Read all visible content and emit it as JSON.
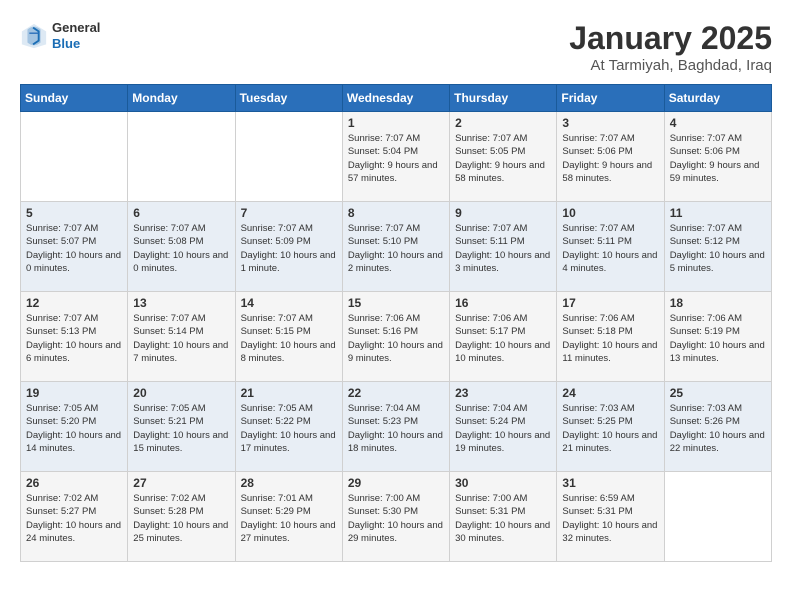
{
  "header": {
    "logo_general": "General",
    "logo_blue": "Blue",
    "title": "January 2025",
    "subtitle": "At Tarmiyah, Baghdad, Iraq"
  },
  "days_of_week": [
    "Sunday",
    "Monday",
    "Tuesday",
    "Wednesday",
    "Thursday",
    "Friday",
    "Saturday"
  ],
  "weeks": [
    [
      {
        "day": "",
        "info": ""
      },
      {
        "day": "",
        "info": ""
      },
      {
        "day": "",
        "info": ""
      },
      {
        "day": "1",
        "info": "Sunrise: 7:07 AM\nSunset: 5:04 PM\nDaylight: 9 hours and 57 minutes."
      },
      {
        "day": "2",
        "info": "Sunrise: 7:07 AM\nSunset: 5:05 PM\nDaylight: 9 hours and 58 minutes."
      },
      {
        "day": "3",
        "info": "Sunrise: 7:07 AM\nSunset: 5:06 PM\nDaylight: 9 hours and 58 minutes."
      },
      {
        "day": "4",
        "info": "Sunrise: 7:07 AM\nSunset: 5:06 PM\nDaylight: 9 hours and 59 minutes."
      }
    ],
    [
      {
        "day": "5",
        "info": "Sunrise: 7:07 AM\nSunset: 5:07 PM\nDaylight: 10 hours and 0 minutes."
      },
      {
        "day": "6",
        "info": "Sunrise: 7:07 AM\nSunset: 5:08 PM\nDaylight: 10 hours and 0 minutes."
      },
      {
        "day": "7",
        "info": "Sunrise: 7:07 AM\nSunset: 5:09 PM\nDaylight: 10 hours and 1 minute."
      },
      {
        "day": "8",
        "info": "Sunrise: 7:07 AM\nSunset: 5:10 PM\nDaylight: 10 hours and 2 minutes."
      },
      {
        "day": "9",
        "info": "Sunrise: 7:07 AM\nSunset: 5:11 PM\nDaylight: 10 hours and 3 minutes."
      },
      {
        "day": "10",
        "info": "Sunrise: 7:07 AM\nSunset: 5:11 PM\nDaylight: 10 hours and 4 minutes."
      },
      {
        "day": "11",
        "info": "Sunrise: 7:07 AM\nSunset: 5:12 PM\nDaylight: 10 hours and 5 minutes."
      }
    ],
    [
      {
        "day": "12",
        "info": "Sunrise: 7:07 AM\nSunset: 5:13 PM\nDaylight: 10 hours and 6 minutes."
      },
      {
        "day": "13",
        "info": "Sunrise: 7:07 AM\nSunset: 5:14 PM\nDaylight: 10 hours and 7 minutes."
      },
      {
        "day": "14",
        "info": "Sunrise: 7:07 AM\nSunset: 5:15 PM\nDaylight: 10 hours and 8 minutes."
      },
      {
        "day": "15",
        "info": "Sunrise: 7:06 AM\nSunset: 5:16 PM\nDaylight: 10 hours and 9 minutes."
      },
      {
        "day": "16",
        "info": "Sunrise: 7:06 AM\nSunset: 5:17 PM\nDaylight: 10 hours and 10 minutes."
      },
      {
        "day": "17",
        "info": "Sunrise: 7:06 AM\nSunset: 5:18 PM\nDaylight: 10 hours and 11 minutes."
      },
      {
        "day": "18",
        "info": "Sunrise: 7:06 AM\nSunset: 5:19 PM\nDaylight: 10 hours and 13 minutes."
      }
    ],
    [
      {
        "day": "19",
        "info": "Sunrise: 7:05 AM\nSunset: 5:20 PM\nDaylight: 10 hours and 14 minutes."
      },
      {
        "day": "20",
        "info": "Sunrise: 7:05 AM\nSunset: 5:21 PM\nDaylight: 10 hours and 15 minutes."
      },
      {
        "day": "21",
        "info": "Sunrise: 7:05 AM\nSunset: 5:22 PM\nDaylight: 10 hours and 17 minutes."
      },
      {
        "day": "22",
        "info": "Sunrise: 7:04 AM\nSunset: 5:23 PM\nDaylight: 10 hours and 18 minutes."
      },
      {
        "day": "23",
        "info": "Sunrise: 7:04 AM\nSunset: 5:24 PM\nDaylight: 10 hours and 19 minutes."
      },
      {
        "day": "24",
        "info": "Sunrise: 7:03 AM\nSunset: 5:25 PM\nDaylight: 10 hours and 21 minutes."
      },
      {
        "day": "25",
        "info": "Sunrise: 7:03 AM\nSunset: 5:26 PM\nDaylight: 10 hours and 22 minutes."
      }
    ],
    [
      {
        "day": "26",
        "info": "Sunrise: 7:02 AM\nSunset: 5:27 PM\nDaylight: 10 hours and 24 minutes."
      },
      {
        "day": "27",
        "info": "Sunrise: 7:02 AM\nSunset: 5:28 PM\nDaylight: 10 hours and 25 minutes."
      },
      {
        "day": "28",
        "info": "Sunrise: 7:01 AM\nSunset: 5:29 PM\nDaylight: 10 hours and 27 minutes."
      },
      {
        "day": "29",
        "info": "Sunrise: 7:00 AM\nSunset: 5:30 PM\nDaylight: 10 hours and 29 minutes."
      },
      {
        "day": "30",
        "info": "Sunrise: 7:00 AM\nSunset: 5:31 PM\nDaylight: 10 hours and 30 minutes."
      },
      {
        "day": "31",
        "info": "Sunrise: 6:59 AM\nSunset: 5:31 PM\nDaylight: 10 hours and 32 minutes."
      },
      {
        "day": "",
        "info": ""
      }
    ]
  ]
}
